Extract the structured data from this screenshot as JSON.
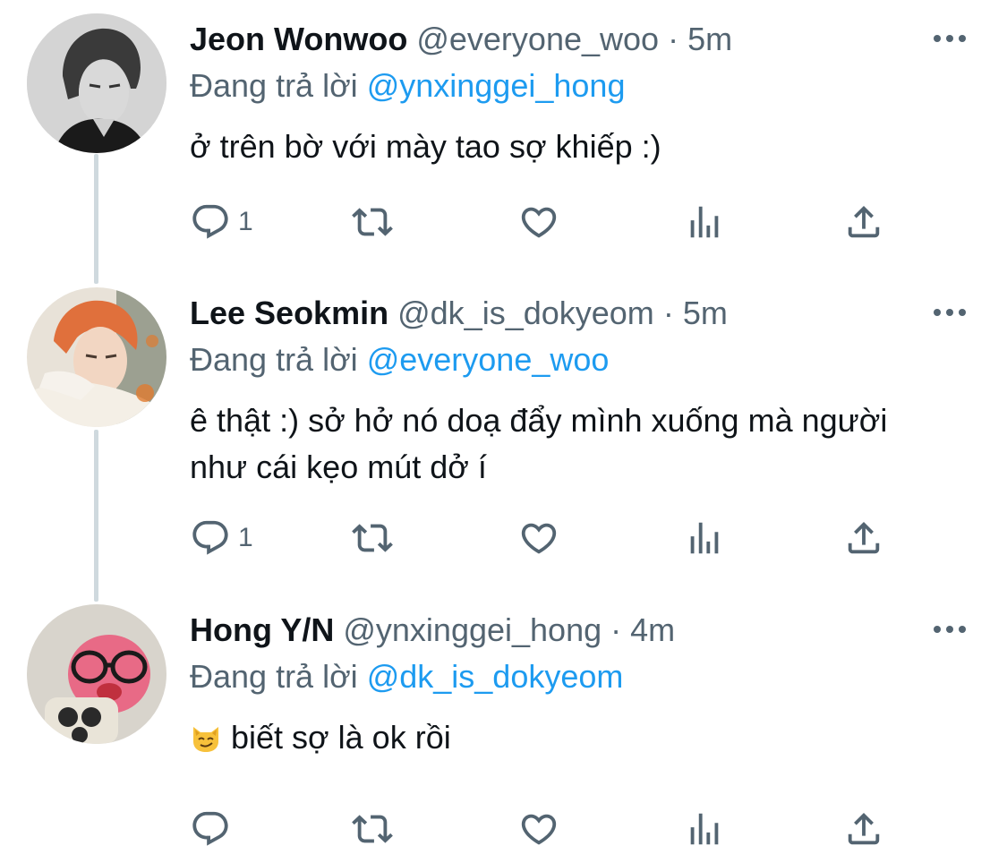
{
  "tweets": [
    {
      "name": "Jeon Wonwoo",
      "handle": "@everyone_woo",
      "separator": "·",
      "time": "5m",
      "reply_prefix": "Đang trả lời",
      "reply_to": "@ynxinggei_hong",
      "text": "ở trên bờ với mày tao sợ khiếp :)",
      "emoji": "",
      "actions": {
        "reply_count": "1",
        "retweet_count": "",
        "like_count": ""
      }
    },
    {
      "name": "Lee Seokmin",
      "handle": "@dk_is_dokyeom",
      "separator": "·",
      "time": "5m",
      "reply_prefix": "Đang trả lời",
      "reply_to": "@everyone_woo",
      "text": "ê thật :) sở hở nó doạ đẩy mình xuống mà người như cái kẹo mút dở í",
      "emoji": "",
      "actions": {
        "reply_count": "1",
        "retweet_count": "",
        "like_count": ""
      }
    },
    {
      "name": "Hong Y/N",
      "handle": "@ynxinggei_hong",
      "separator": "·",
      "time": "4m",
      "reply_prefix": "Đang trả lời",
      "reply_to": "@dk_is_dokyeom",
      "text": "biết sợ là ok rồi",
      "emoji": "smirking-cat-emoji",
      "actions": {
        "reply_count": "",
        "retweet_count": "",
        "like_count": ""
      }
    }
  ],
  "icons": {
    "reply": "reply-icon",
    "retweet": "retweet-icon",
    "like": "heart-icon",
    "views": "analytics-icon",
    "share": "share-icon",
    "more": "more-icon"
  },
  "colors": {
    "text": "#0f1419",
    "secondary": "#536471",
    "accent": "#1d9bf0",
    "thread_line": "#cfd9de"
  }
}
